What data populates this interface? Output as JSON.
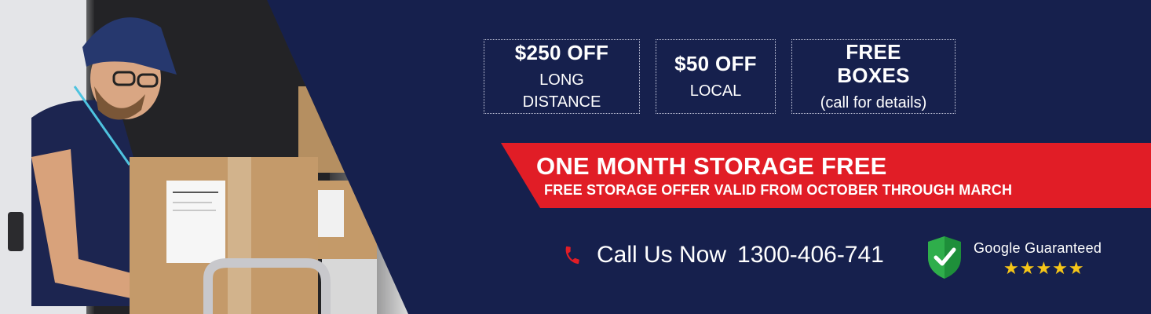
{
  "offers": [
    {
      "headline": "$250 OFF",
      "detail": "LONG DISTANCE"
    },
    {
      "headline": "$50 OFF",
      "detail": "LOCAL"
    },
    {
      "headline": "FREE BOXES",
      "detail": "(call for details)"
    }
  ],
  "storage": {
    "title": "ONE MONTH STORAGE FREE",
    "subtitle": "FREE STORAGE OFFER VALID FROM OCTOBER THROUGH MARCH"
  },
  "call": {
    "label": "Call Us Now",
    "number": "1300-406-741",
    "icon": "phone-icon"
  },
  "google": {
    "label": "Google Guaranteed",
    "stars": "★★★★★",
    "rating": 5,
    "icon": "shield-check-icon"
  },
  "colors": {
    "background": "#16204d",
    "ribbon": "#e11d26",
    "star": "#f5c518",
    "shield": "#1e8f3a"
  }
}
